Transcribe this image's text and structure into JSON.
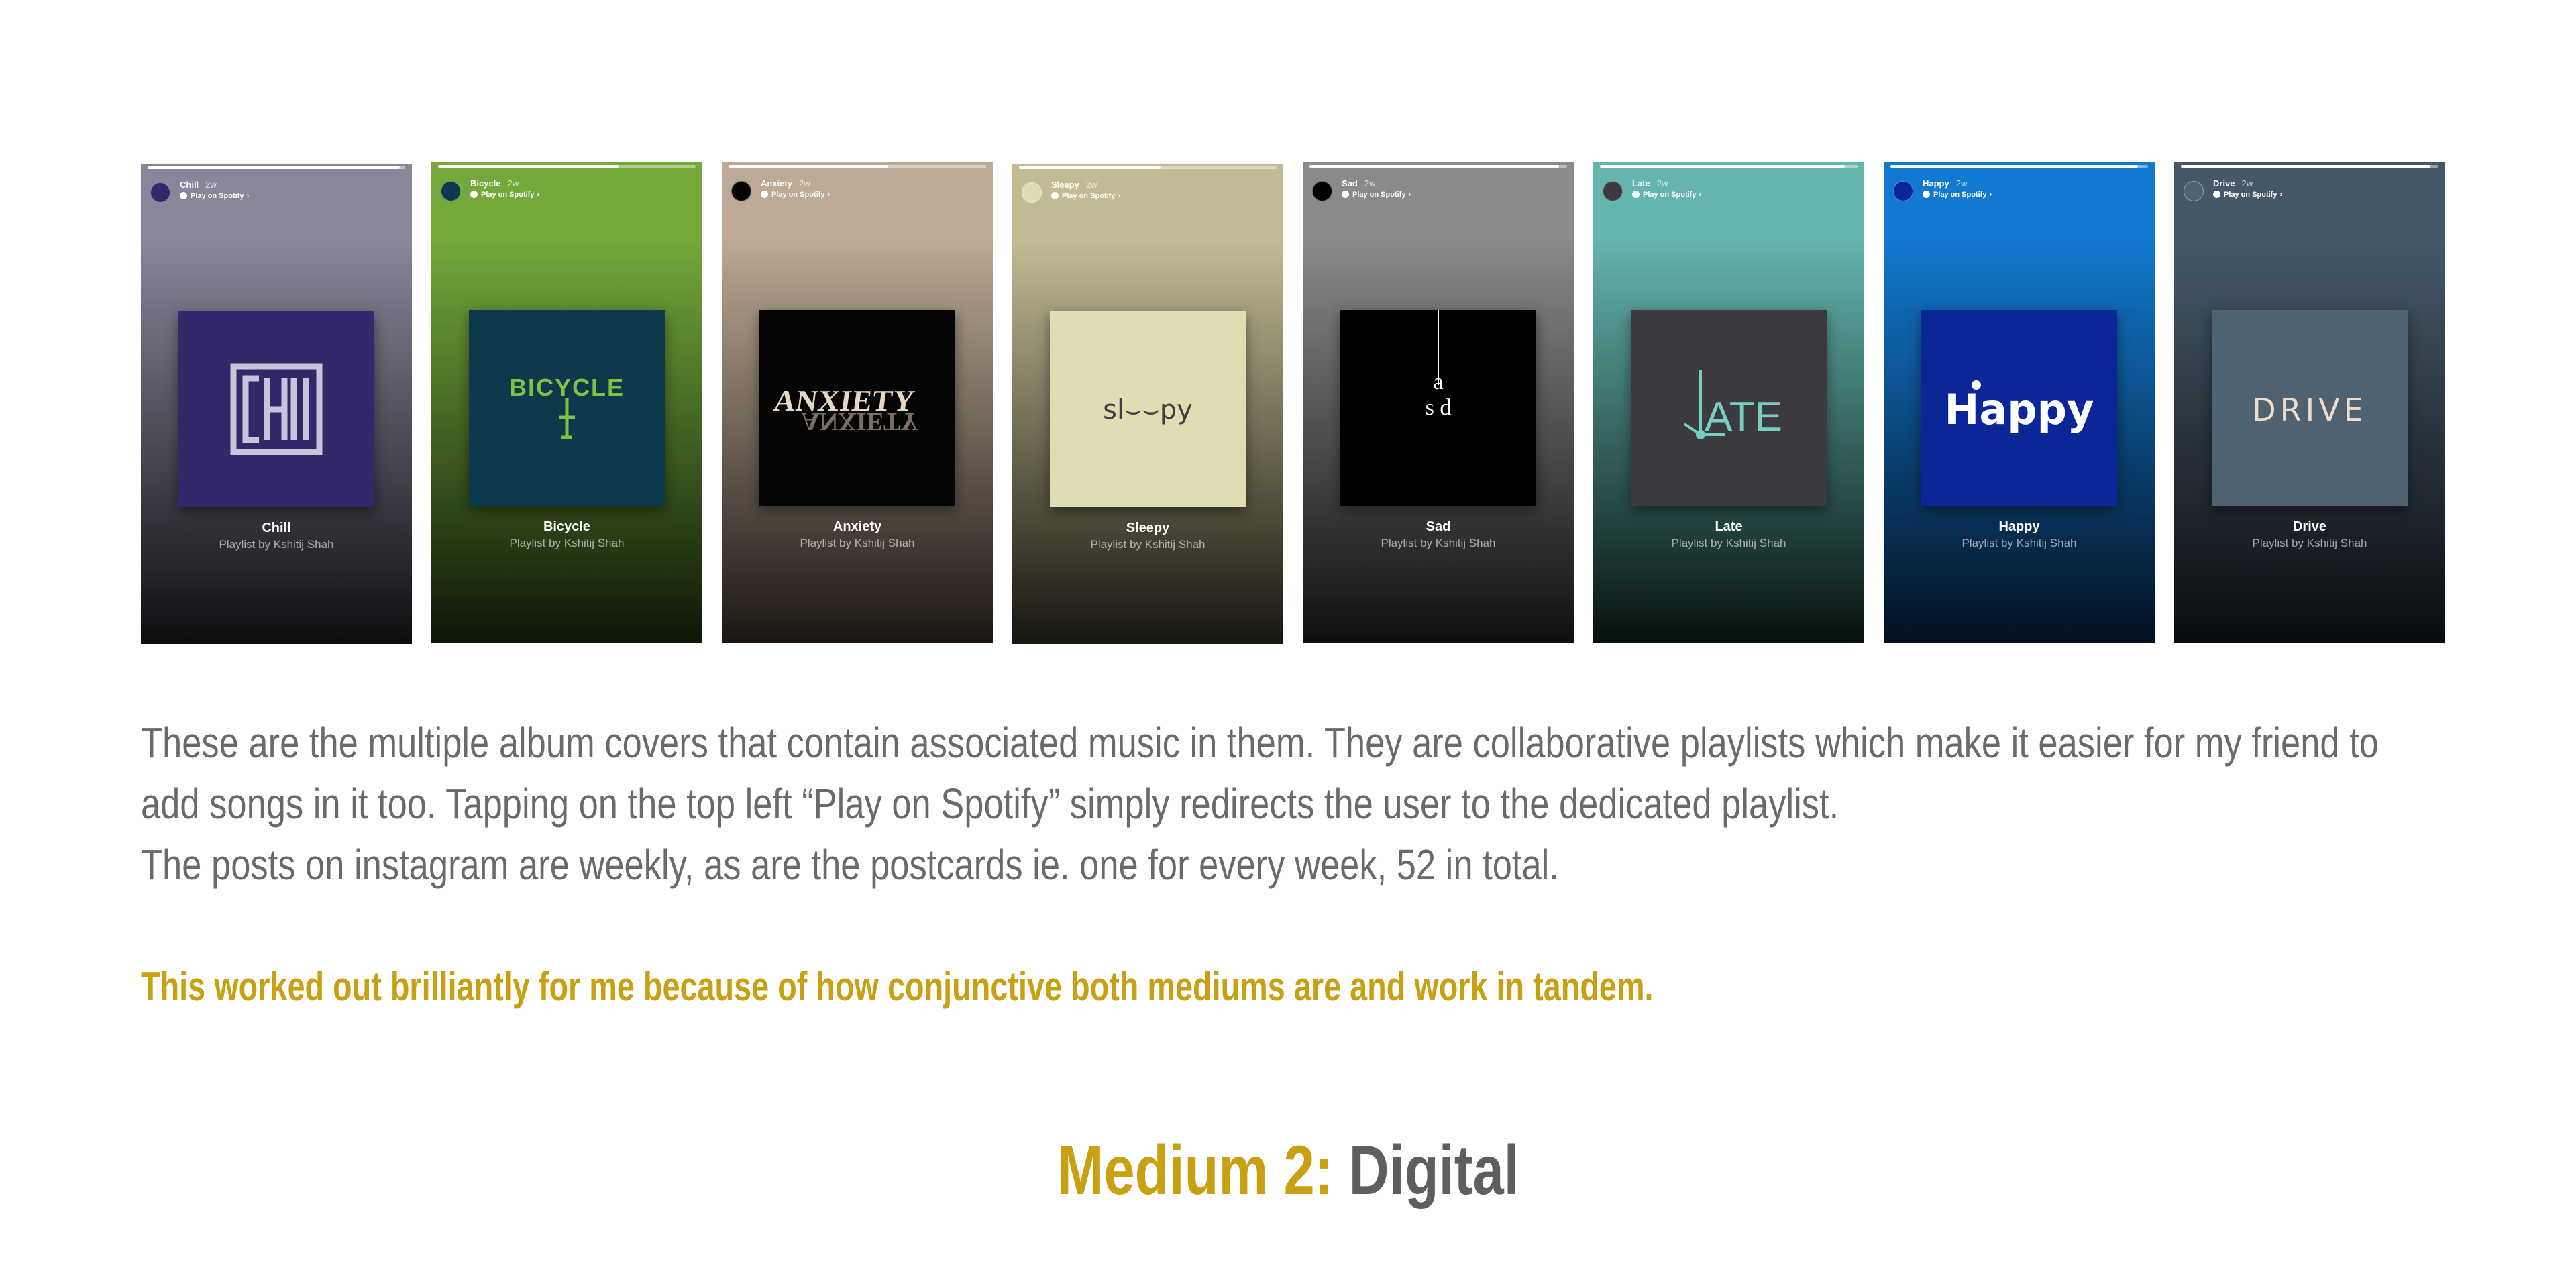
{
  "stories": [
    {
      "name": "Chill",
      "time": "2w",
      "play_label": "Play on Spotify",
      "title": "Chill",
      "subtitle": "Playlist by Kshitij Shah",
      "bg_top": "#8a8599",
      "bg_bottom": "#0e0e10",
      "cover_bg": "#33286a",
      "cover_text": "CHILL",
      "cover_color": "#c8c4dc"
    },
    {
      "name": "Bicycle",
      "time": "2w",
      "play_label": "Play on Spotify",
      "title": "Bicycle",
      "subtitle": "Playlist by Kshitij Shah",
      "bg_top": "#74a83a",
      "bg_bottom": "#0d1608",
      "cover_bg": "#0c3a4c",
      "cover_text": "BICYCLE",
      "cover_color": "#7fc241"
    },
    {
      "name": "Anxiety",
      "time": "2w",
      "play_label": "Play on Spotify",
      "title": "Anxiety",
      "subtitle": "Playlist by Kshitij Shah",
      "bg_top": "#bca996",
      "bg_bottom": "#1b1612",
      "cover_bg": "#050505",
      "cover_text": "ANXIETY",
      "cover_color": "#e9d7c4"
    },
    {
      "name": "Sleepy",
      "time": "2w",
      "play_label": "Play on Spotify",
      "title": "Sleepy",
      "subtitle": "Playlist by Kshitij Shah",
      "bg_top": "#c2bb96",
      "bg_bottom": "#16150f",
      "cover_bg": "#e0ddb2",
      "cover_text": "sl⌣⌣py",
      "cover_color": "#3f3f3f"
    },
    {
      "name": "Sad",
      "time": "2w",
      "play_label": "Play on Spotify",
      "title": "Sad",
      "subtitle": "Playlist by Kshitij Shah",
      "bg_top": "#8a8a8a",
      "bg_bottom": "#0f0f0f",
      "cover_bg": "#000000",
      "cover_text": "sad",
      "cover_color": "#ffffff"
    },
    {
      "name": "Late",
      "time": "2w",
      "play_label": "Play on Spotify",
      "title": "Late",
      "subtitle": "Playlist by Kshitij Shah",
      "bg_top": "#64b5ae",
      "bg_bottom": "#07110f",
      "cover_bg": "#3c3a3f",
      "cover_text": "LATE",
      "cover_color": "#75cfc0"
    },
    {
      "name": "Happy",
      "time": "2w",
      "play_label": "Play on Spotify",
      "title": "Happy",
      "subtitle": "Playlist by Kshitij Shah",
      "bg_top": "#1179cf",
      "bg_bottom": "#031020",
      "cover_bg": "#0b2696",
      "cover_text": "Happy",
      "cover_color": "#ffffff"
    },
    {
      "name": "Drive",
      "time": "2w",
      "play_label": "Play on Spotify",
      "title": "Drive",
      "subtitle": "Playlist by Kshitij Shah",
      "bg_top": "#465868",
      "bg_bottom": "#0a0c0f",
      "cover_bg": "#4e6272",
      "cover_text": "DRIVE",
      "cover_color": "#f0dcc8"
    }
  ],
  "body": {
    "paragraph_1": "These are the multiple album covers that contain associated music in them. They are collaborative playlists which make it easier for my friend to add songs in it too. Tapping on the top left “Play on Spotify” simply redirects the user to the dedicated playlist.",
    "paragraph_2": "The posts on instagram are weekly, as are the postcards ie. one for every week, 52 in total."
  },
  "highlight": "This worked out brilliantly for me because of how conjunctive both mediums are and work in tandem.",
  "section": {
    "lead": "Medium 2:",
    "rest": "Digital"
  },
  "colors": {
    "accent": "#c9a012",
    "body_text": "#6a6a6a",
    "heading_gray": "#5e5e5e"
  }
}
